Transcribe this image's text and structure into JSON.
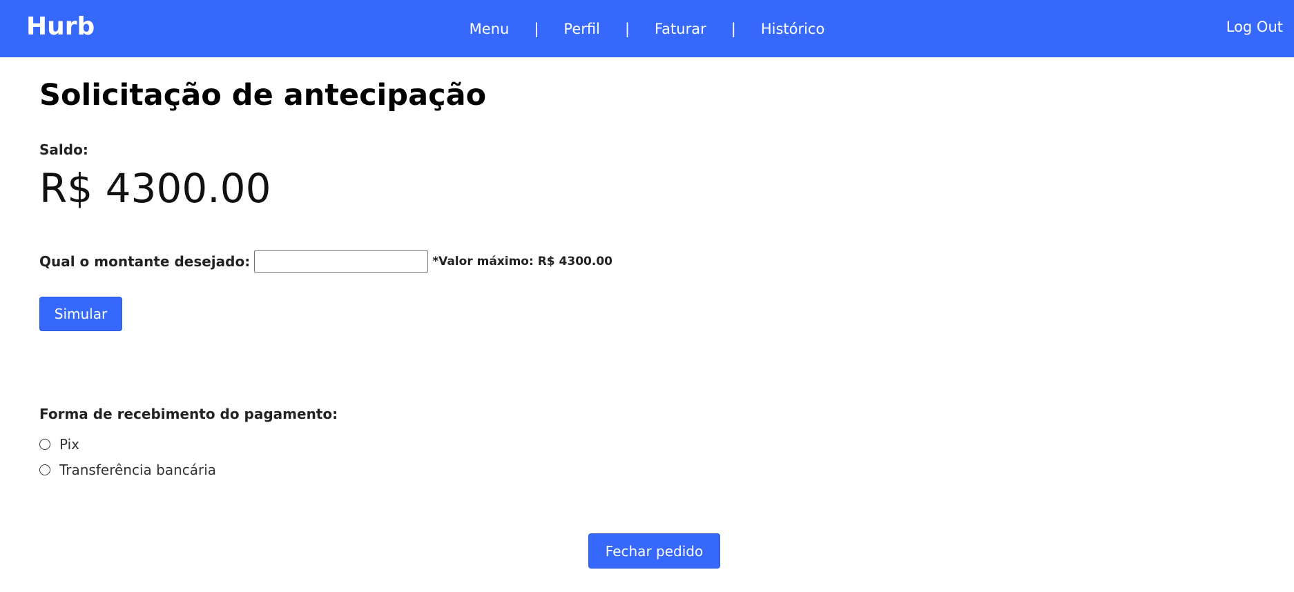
{
  "navbar": {
    "brand": "Hurb",
    "links": [
      "Menu",
      "Perfil",
      "Faturar",
      "Histórico"
    ],
    "separator": "|",
    "logout": "Log Out",
    "background_color": "#3669fb"
  },
  "page": {
    "title": "Solicitação de antecipação"
  },
  "balance": {
    "label": "Saldo:",
    "value": "R$ 4300.00"
  },
  "amount": {
    "label": "Qual o montante desejado:",
    "input_value": "",
    "max_note": "*Valor máximo: R$ 4300.00"
  },
  "simulate_button": "Simular",
  "payment": {
    "label": "Forma de recebimento do pagamento:",
    "options": [
      "Pix",
      "Transferência bancária"
    ],
    "selected": null
  },
  "close_button": "Fechar pedido",
  "accent_color": "#3669fb"
}
